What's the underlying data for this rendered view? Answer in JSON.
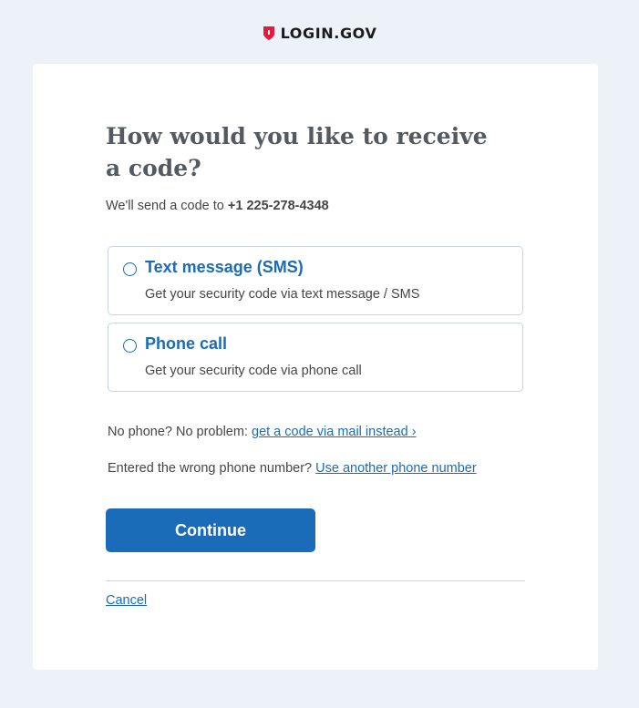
{
  "header": {
    "logo_text": "LOGIN.GOV",
    "logo_icon": "shield-icon"
  },
  "colors": {
    "page_background": "#edf2f8",
    "brand_red": "#e21c3d",
    "primary_blue": "#1a6cb8",
    "heading_gray": "#545a61"
  },
  "main": {
    "title": "How would you like to receive a code?",
    "subtitle_prefix": "We'll send a code to ",
    "phone_number": "+1 225-278-4348",
    "options": [
      {
        "label": "Text message (SMS)",
        "description": "Get your security code via text message / SMS",
        "selected": false
      },
      {
        "label": "Phone call",
        "description": "Get your security code via phone call",
        "selected": false
      }
    ],
    "mail_prefix": "No phone? No problem: ",
    "mail_link": "get a code via mail instead ›",
    "wrong_prefix": "Entered the wrong phone number? ",
    "wrong_link": "Use another phone number",
    "continue_label": "Continue",
    "cancel_label": "Cancel"
  }
}
